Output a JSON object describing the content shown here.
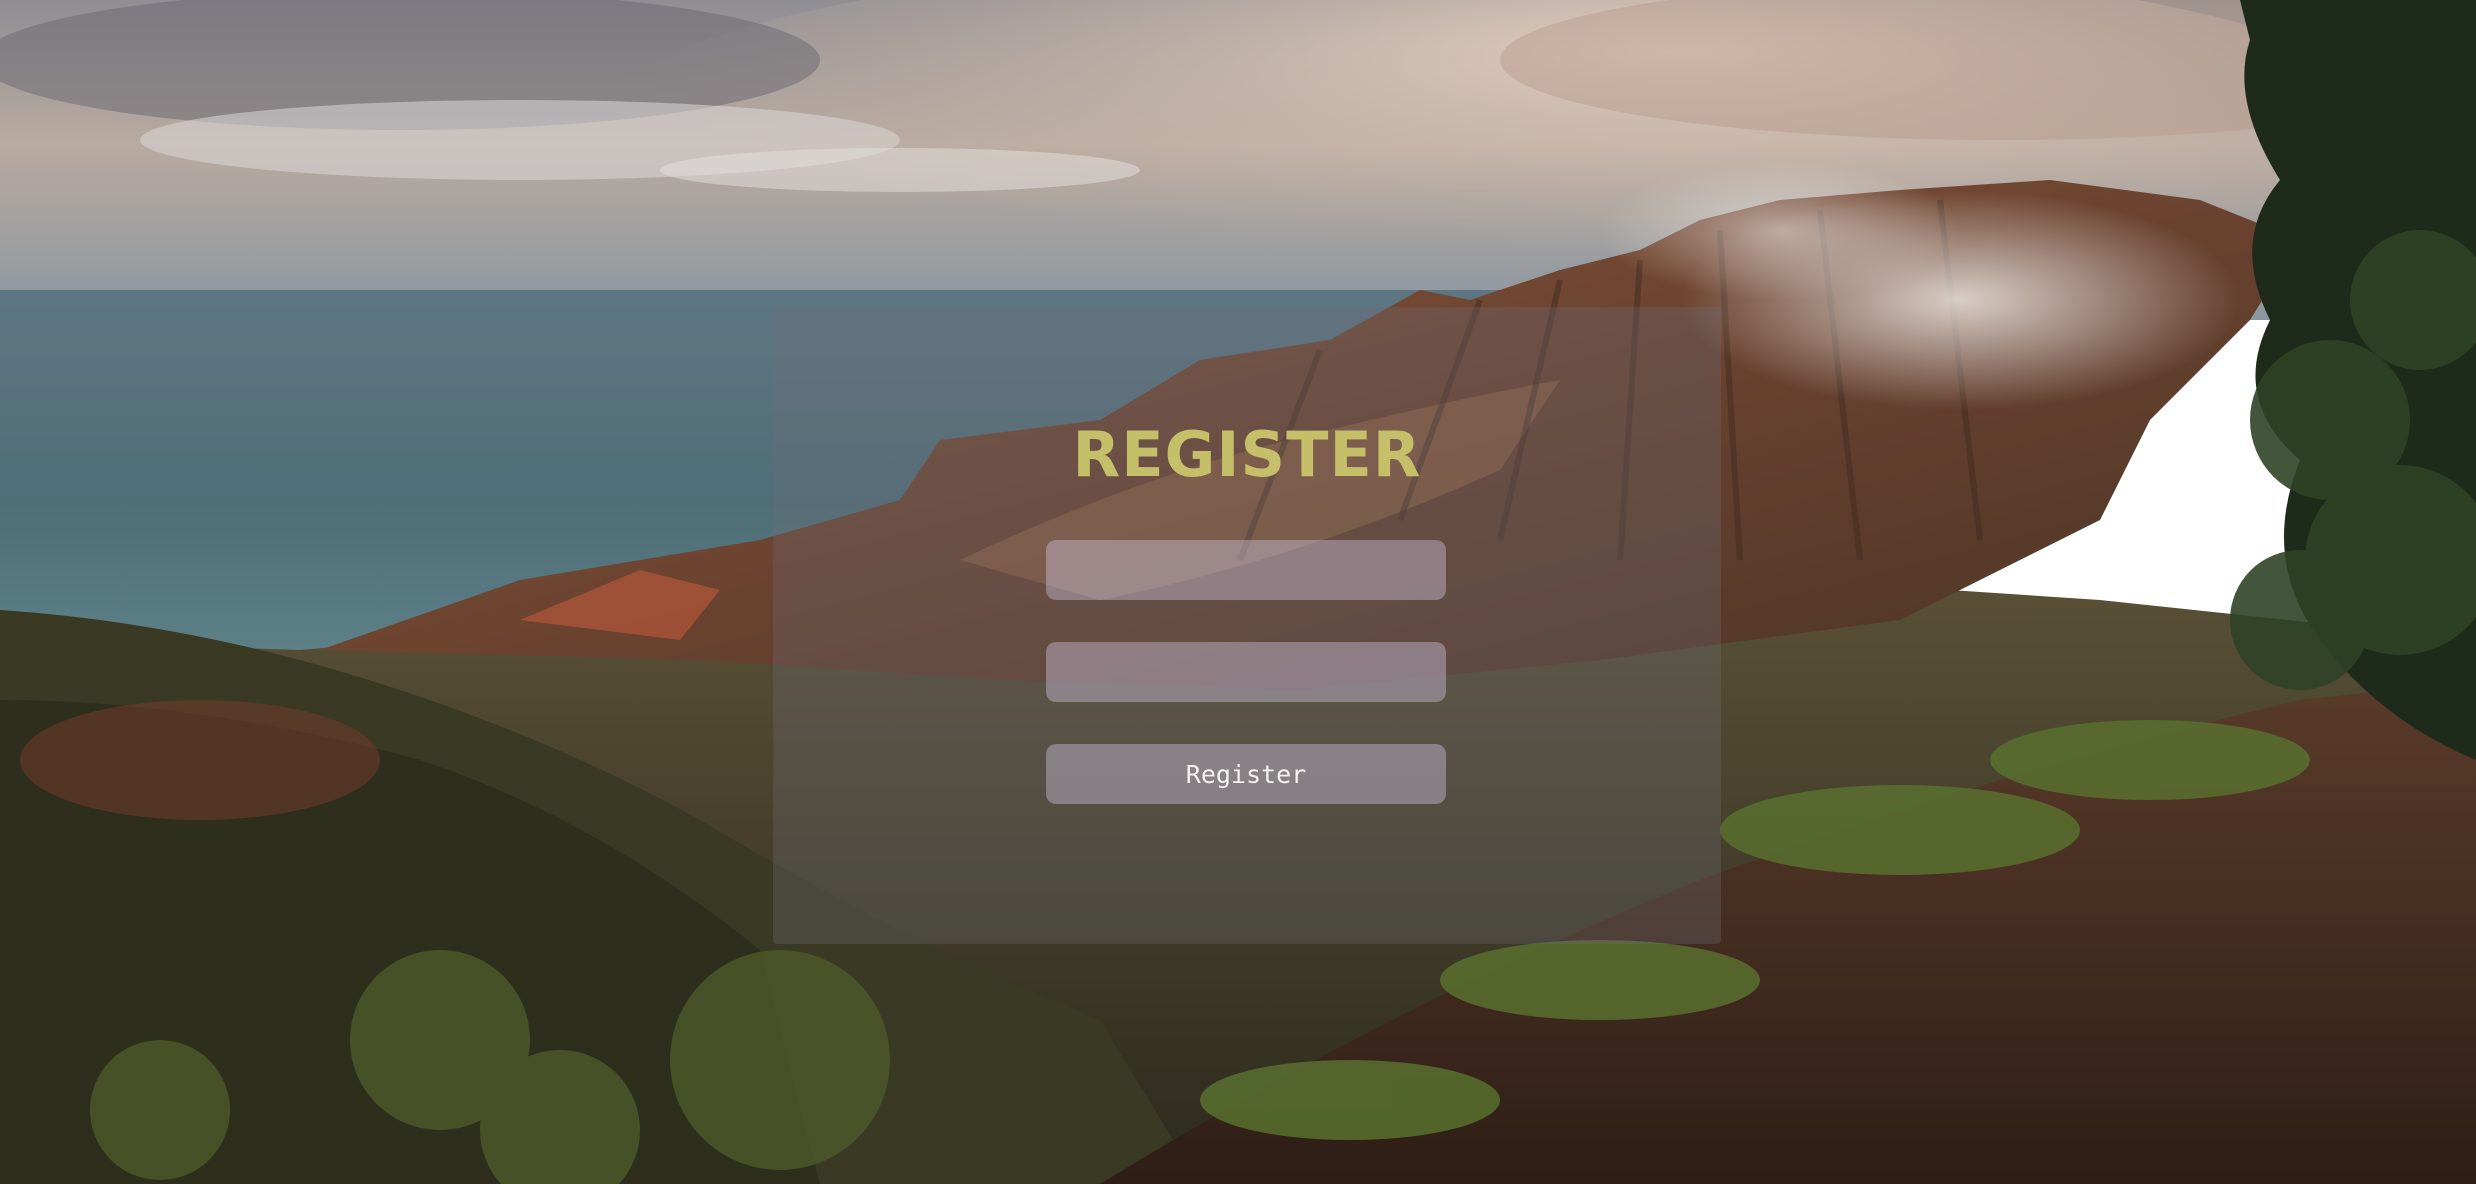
{
  "page": {
    "title": "REGISTER",
    "title_color": "#c6bf6a"
  },
  "form": {
    "fields": [
      {
        "value": "",
        "placeholder": ""
      },
      {
        "value": "",
        "placeholder": ""
      }
    ],
    "submit_label": "Register"
  },
  "colors": {
    "panel": "rgba(110,110,118,0.30)",
    "field": "rgba(205,195,225,0.42)",
    "button_text": "#f4f1ee"
  }
}
